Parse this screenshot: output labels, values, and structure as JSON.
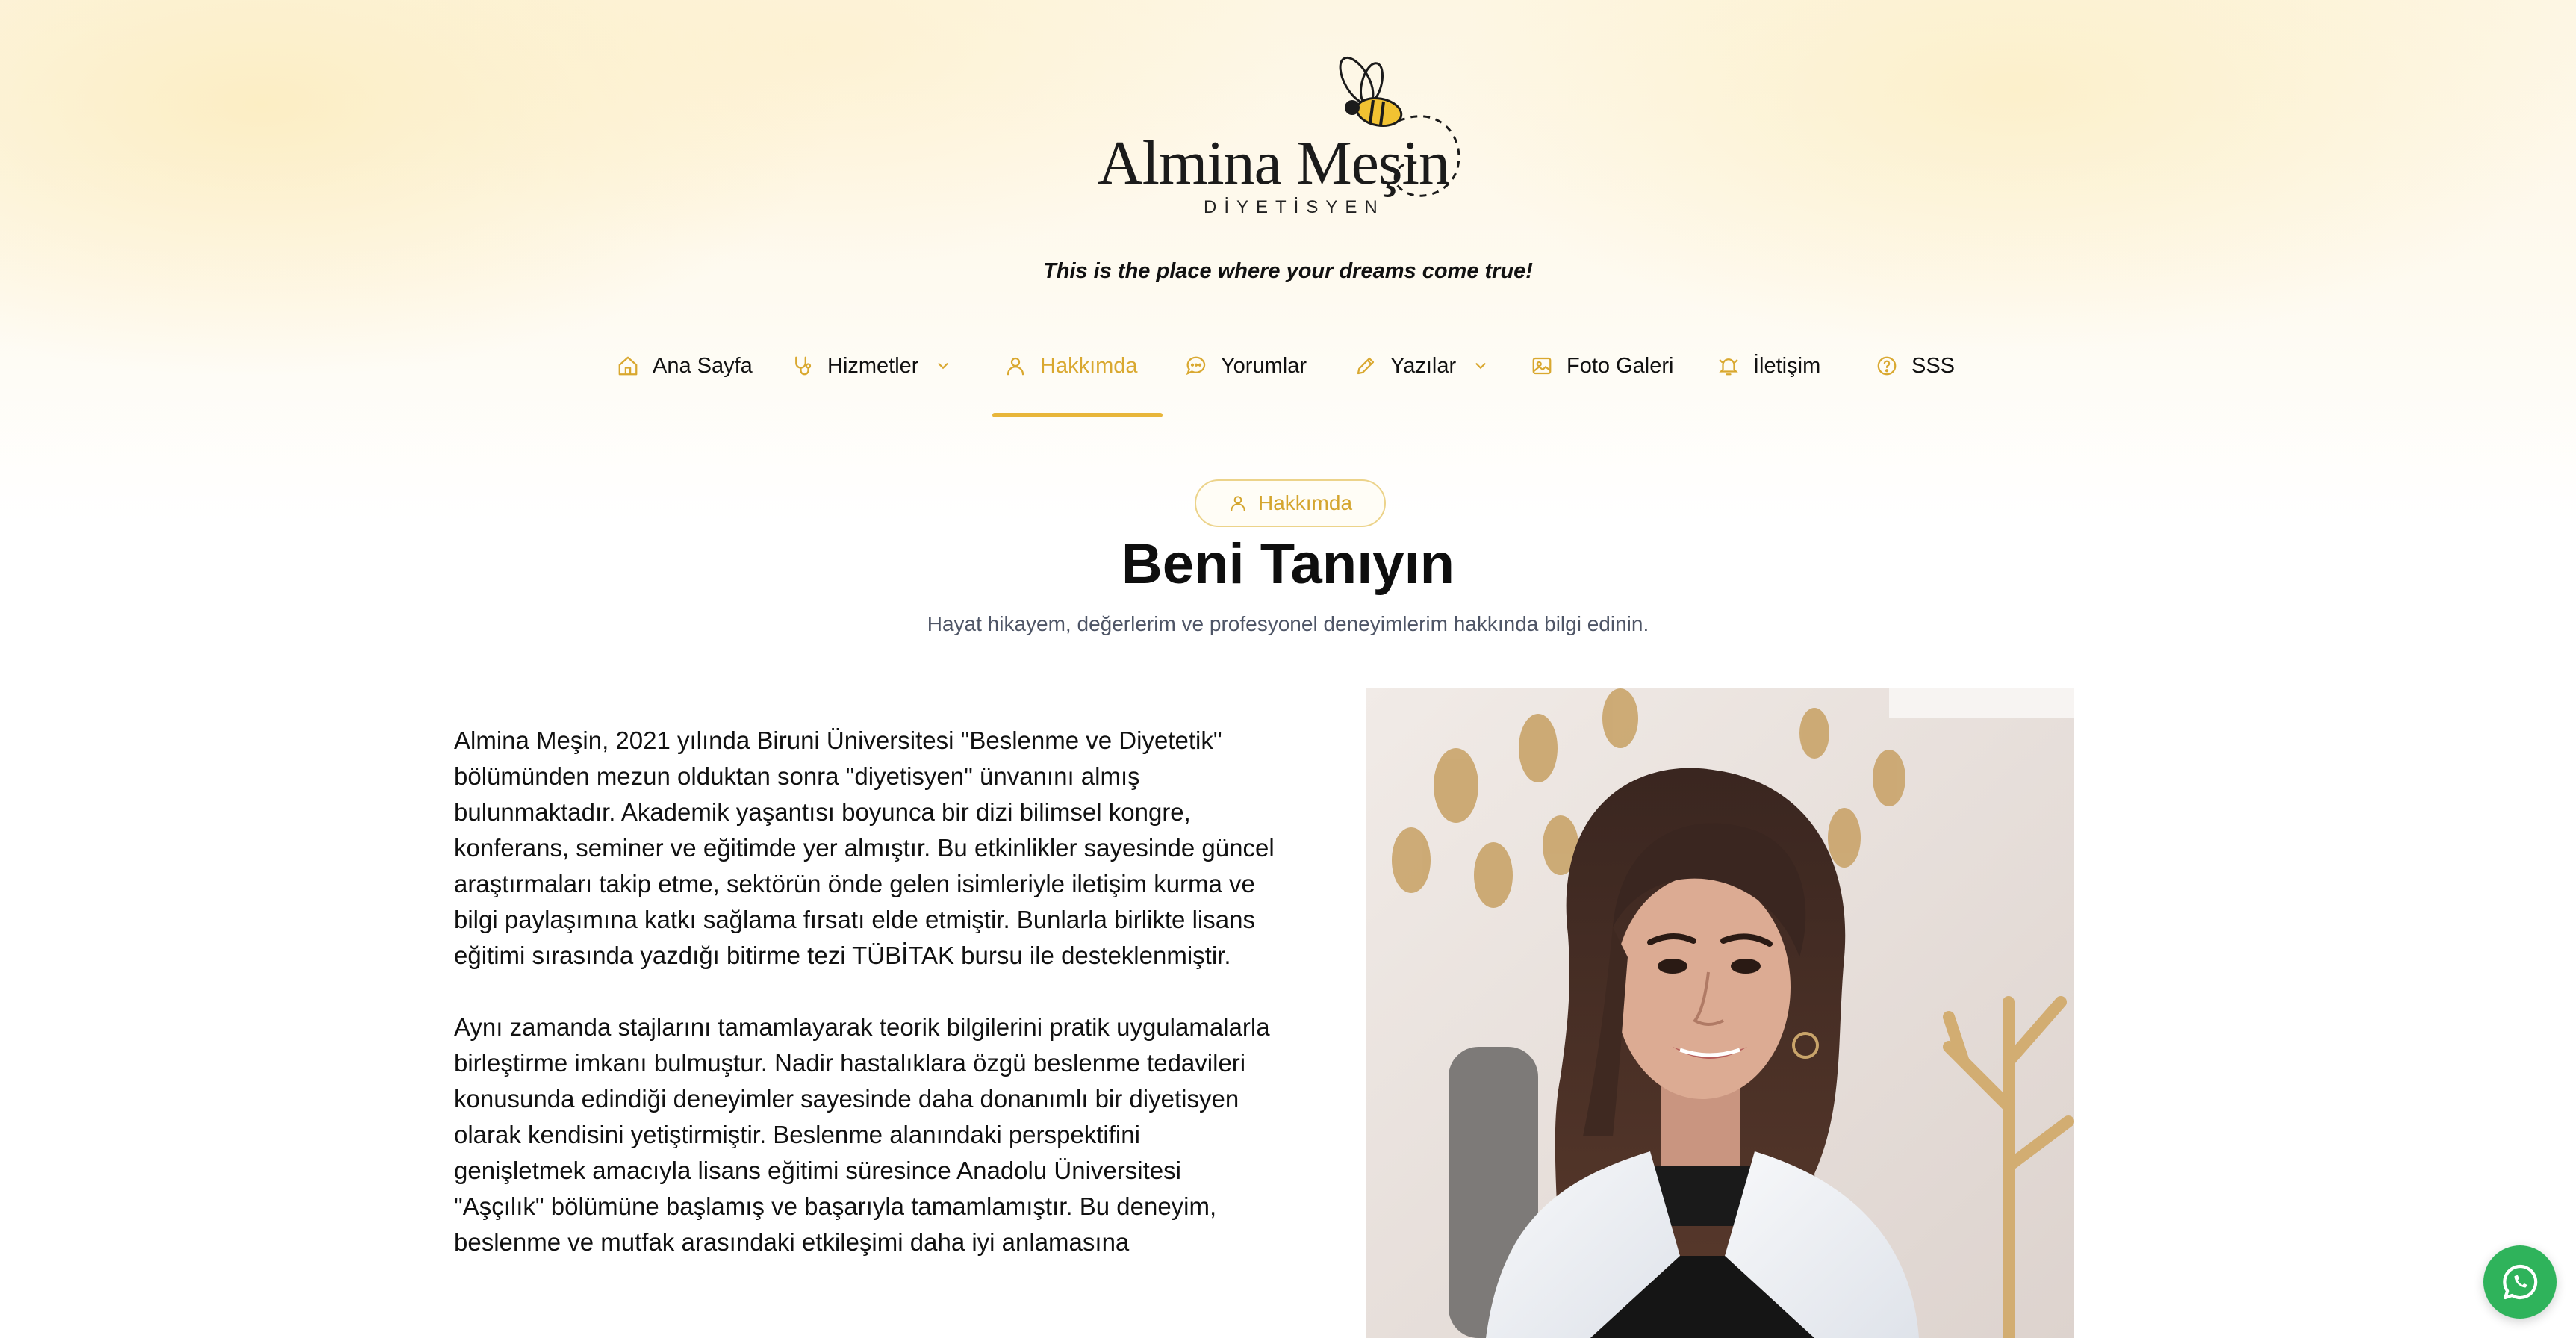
{
  "brand": {
    "name": "Almina Meşin",
    "subtitle": "DİYETİSYEN",
    "tagline": "This is the place where your dreams come true!"
  },
  "nav": {
    "items": [
      {
        "label": "Ana Sayfa",
        "icon": "home-icon"
      },
      {
        "label": "Hizmetler",
        "icon": "stethoscope-icon",
        "dropdown": true
      },
      {
        "label": "Hakkımda",
        "icon": "user-icon",
        "active": true
      },
      {
        "label": "Yorumlar",
        "icon": "chat-icon"
      },
      {
        "label": "Yazılar",
        "icon": "pen-icon",
        "dropdown": true
      },
      {
        "label": "Foto Galeri",
        "icon": "image-icon"
      },
      {
        "label": "İletişim",
        "icon": "bell-icon"
      },
      {
        "label": "SSS",
        "icon": "question-icon"
      }
    ]
  },
  "hero": {
    "badge": "Hakkımda",
    "title": "Beni Tanıyın",
    "subtitle": "Hayat hikayem, değerlerim ve profesyonel deneyimlerim hakkında bilgi edinin."
  },
  "bio": {
    "paragraphs": [
      "Almina Meşin, 2021 yılında Biruni Üniversitesi \"Beslenme ve Diyetetik\" bölümünden mezun olduktan sonra \"diyetisyen\" ünvanını almış bulunmaktadır. Akademik yaşantısı boyunca bir dizi bilimsel kongre, konferans, seminer ve eğitimde yer almıştır. Bu etkinlikler sayesinde güncel araştırmaları takip etme, sektörün önde gelen isimleriyle iletişim kurma ve bilgi paylaşımına katkı sağlama fırsatı elde etmiştir. Bunlarla birlikte lisans eğitimi sırasında yazdığı bitirme tezi TÜBİTAK bursu ile desteklenmiştir.",
      "Aynı zamanda stajlarını tamamlayarak teorik bilgilerini pratik uygulamalarla birleştirme imkanı bulmuştur. Nadir hastalıklara özgü beslenme tedavileri konusunda edindiği deneyimler sayesinde daha donanımlı bir diyetisyen olarak kendisini yetiştirmiştir. Beslenme alanındaki perspektifini genişletmek amacıyla lisans eğitimi süresince Anadolu Üniversitesi \"Aşçılık\" bölümüne başlamış ve başarıyla tamamlamıştır. Bu deneyim, beslenme ve mutfak arasındaki etkileşimi daha iyi anlamasına"
    ]
  },
  "colors": {
    "accent": "#e8b63a",
    "accent_text": "#d9a82f",
    "whatsapp": "#2fb35b"
  }
}
